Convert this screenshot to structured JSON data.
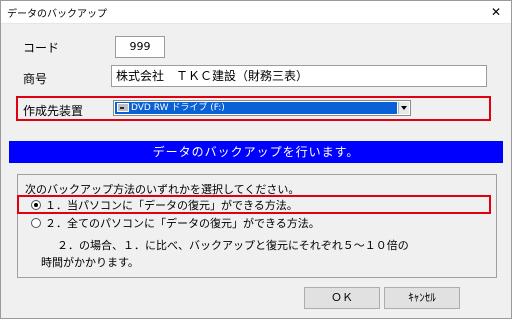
{
  "window": {
    "title": "データのバックアップ",
    "close_glyph": "✕"
  },
  "form": {
    "code_label": "コード",
    "code_value": "999",
    "company_label": "商号",
    "company_value": "株式会社　ＴＫＣ建設（財務三表）",
    "device_label": "作成先装置",
    "device_value": "DVD RW ドライブ (F:)"
  },
  "banner": {
    "text": "データのバックアップを行います。"
  },
  "options": {
    "prompt": "次のバックアップ方法のいずれかを選択してください。",
    "items": [
      {
        "label": "１．当パソコンに「データの復元」ができる方法。",
        "selected": true
      },
      {
        "label": "２．全てのパソコンに「データの復元」ができる方法。",
        "selected": false
      }
    ],
    "note_line1": "２．の場合、１．に比べ、バックアップと復元にそれぞれ５～１０倍の",
    "note_line2": "時間がかかります。"
  },
  "buttons": {
    "ok": "ＯＫ",
    "cancel": "ｷｬﾝｾﾙ"
  },
  "colors": {
    "banner": "#0000ff",
    "highlight_frame": "#e00010",
    "selection": "#0a61d6"
  },
  "icons": {
    "device": "drive-icon",
    "dropdown": "chevron-down-icon",
    "close": "close-icon"
  }
}
